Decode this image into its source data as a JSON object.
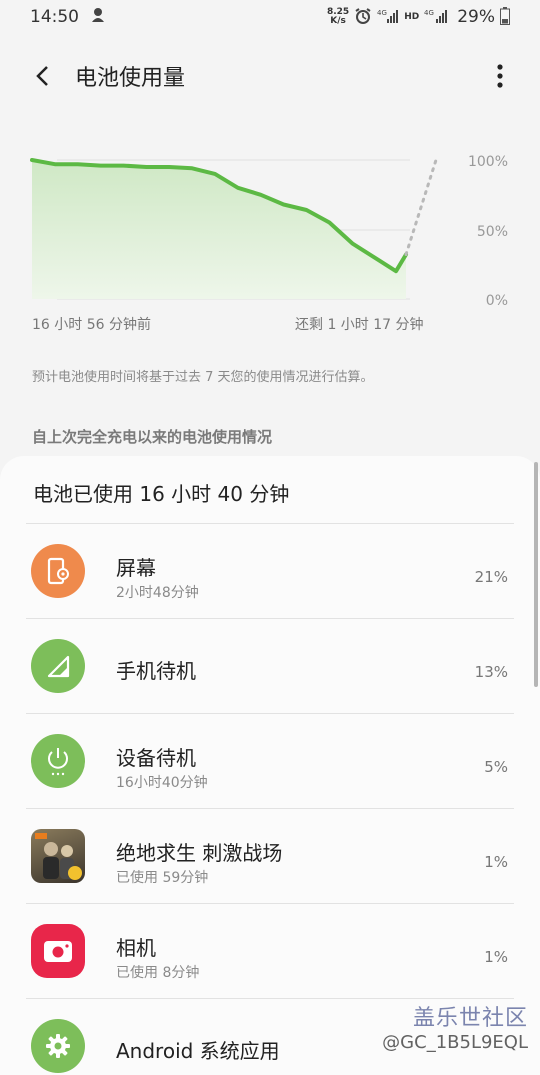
{
  "status_bar": {
    "time": "14:50",
    "speed_value": "8.25",
    "speed_unit": "K/s",
    "net_hd": "HD",
    "net_4g": "4G",
    "battery": "29%"
  },
  "header": {
    "title": "电池使用量"
  },
  "chart_data": {
    "type": "area",
    "y_ticks": [
      "100%",
      "50%",
      "0%"
    ],
    "x_start": "16 小时 56 分钟前",
    "x_end": "还剩 1 小时 17 分钟",
    "ylim": [
      0,
      100
    ],
    "series": [
      {
        "points": [
          100,
          97,
          97,
          96,
          96,
          95,
          95,
          94,
          90,
          80,
          75,
          68,
          64,
          55,
          40,
          20,
          32
        ],
        "style": "solid",
        "color": "#5cb944"
      },
      {
        "points": [
          32,
          100
        ],
        "style": "dotted",
        "color": "#b8b8b8"
      }
    ]
  },
  "description": "预计电池使用时间将基于过去 7 天您的使用情况进行估算。",
  "section_title": "自上次完全充电以来的电池使用情况",
  "card": {
    "header": "电池已使用 16 小时 40 分钟",
    "items": [
      {
        "name": "屏幕",
        "sub": "2小时48分钟",
        "percent": "21%",
        "icon": "screen-icon",
        "color": "#ef8a4c"
      },
      {
        "name": "手机待机",
        "sub": "",
        "percent": "13%",
        "icon": "signal-icon",
        "color": "#7dbe5a"
      },
      {
        "name": "设备待机",
        "sub": "16小时40分钟",
        "percent": "5%",
        "icon": "power-icon",
        "color": "#7dbe5a"
      },
      {
        "name": "绝地求生 刺激战场",
        "sub": "已使用 59分钟",
        "percent": "1%",
        "icon": "game-app-icon",
        "color": "#5a4a3a"
      },
      {
        "name": "相机",
        "sub": "已使用 8分钟",
        "percent": "1%",
        "icon": "camera-icon",
        "color": "#e8264a"
      },
      {
        "name": "Android 系统应用",
        "sub": "",
        "percent": "",
        "icon": "gear-icon",
        "color": "#7dbe5a"
      }
    ]
  },
  "watermark": {
    "line1": "盖乐世社区",
    "line2": "@GC_1B5L9EQL"
  }
}
